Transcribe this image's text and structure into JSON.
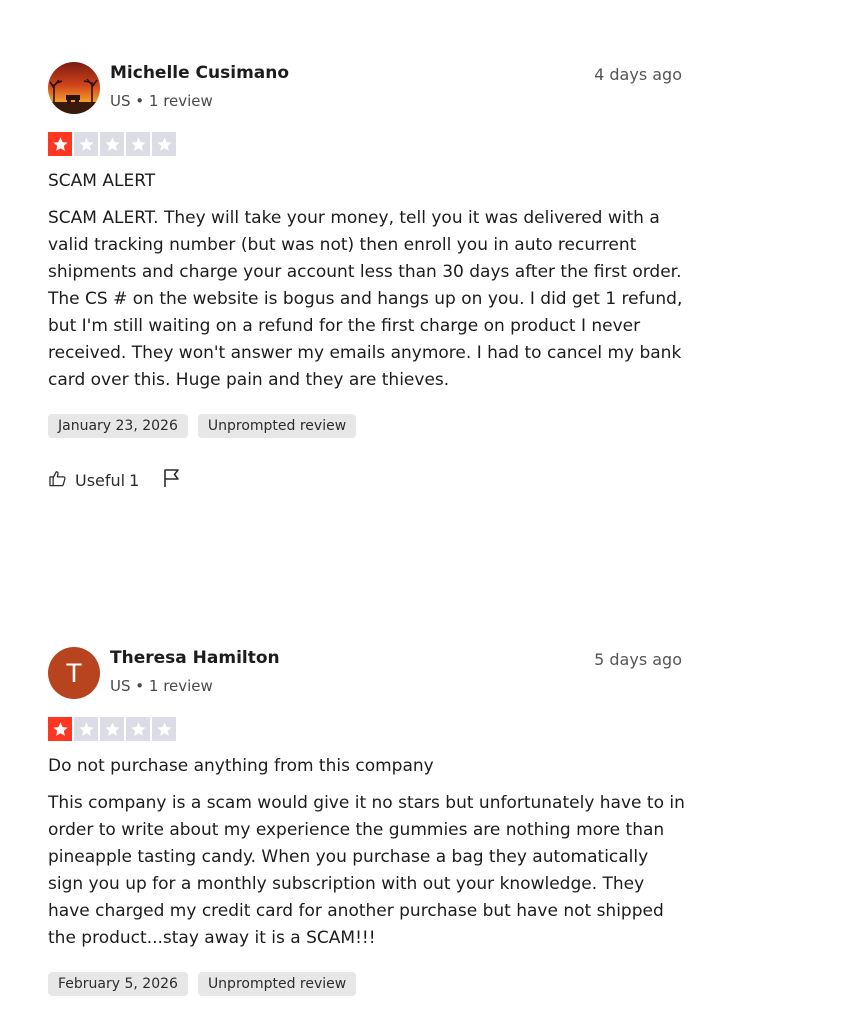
{
  "reviews": [
    {
      "name": "Michelle Cusimano",
      "meta": "US • 1 review",
      "relative_date": "4 days ago",
      "rating": 1,
      "title": "SCAM ALERT",
      "body": "SCAM ALERT. They will take your money, tell you it was delivered with a valid tracking number (but was not) then enroll you in auto recurrent shipments and charge your account less than 30 days after the first order. The CS # on the website is bogus and hangs up on you. I did get 1 refund, but I'm still waiting on a refund for the first charge on product I never received. They won't answer my emails anymore. I had to cancel my bank card over this. Huge pain and they are thieves.",
      "experience_date": "January 23, 2026",
      "review_type": "Unprompted review",
      "useful_label": "Useful",
      "useful_count": "1"
    },
    {
      "name": "Theresa Hamilton",
      "avatar_letter": "T",
      "meta": "US • 1 review",
      "relative_date": "5 days ago",
      "rating": 1,
      "title": "Do not purchase anything from this company",
      "body": "This company is a scam would give it no stars but unfortunately have to in order to write about my experience the gummies are nothing more than pineapple tasting candy. When you purchase a bag they automatically sign you up for a monthly subscription with out your knowledge. They have charged my credit card for another purchase but have not shipped the product...stay away it is a SCAM!!!",
      "experience_date": "February 5, 2026",
      "review_type": "Unprompted review"
    }
  ],
  "colors": {
    "star_filled": "#ff3722",
    "star_empty": "#dcdce6",
    "avatar_letter_bg": "#b8431f",
    "tag_bg": "#e7e7e7"
  },
  "icons": {
    "useful": "thumbs-up-icon",
    "report": "flag-icon",
    "star": "star-icon"
  }
}
